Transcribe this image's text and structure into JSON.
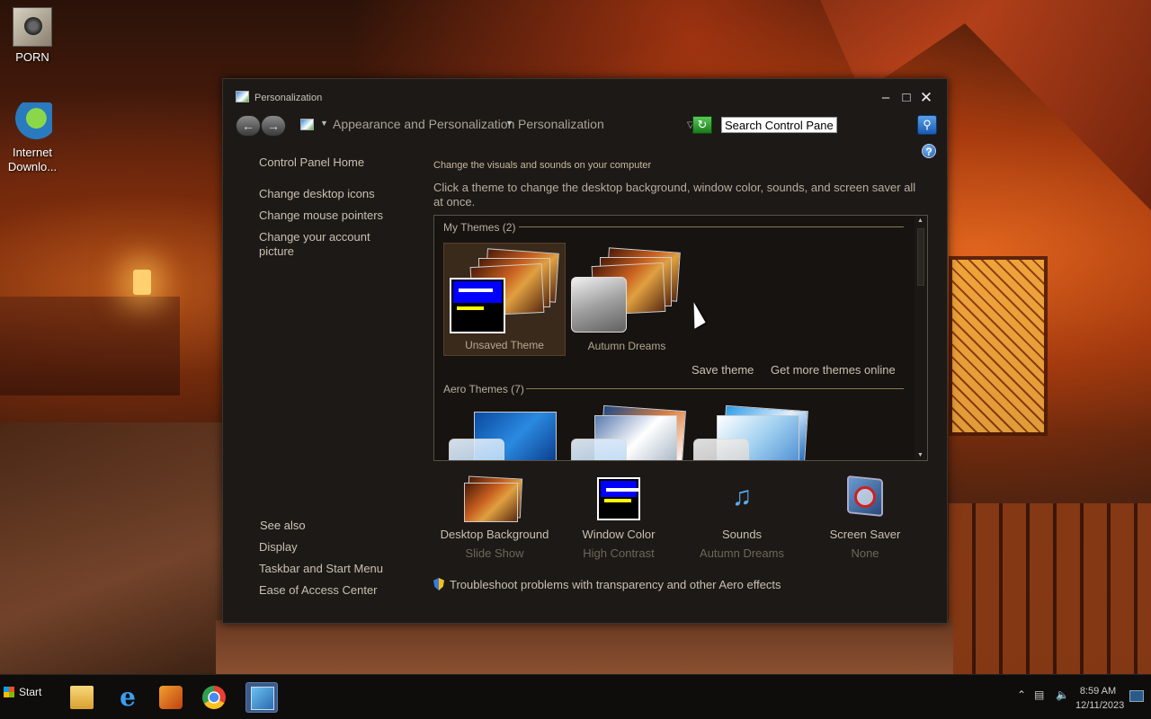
{
  "desktop": {
    "icons": [
      {
        "label": "PORN"
      },
      {
        "label": "Internet Downlo..."
      }
    ]
  },
  "window": {
    "title": "Personalization",
    "breadcrumb": [
      "Appearance and Personalization",
      "Personalization"
    ],
    "search_placeholder": "Search Control Panel"
  },
  "left_pane": {
    "home": "Control Panel Home",
    "links": [
      "Change desktop icons",
      "Change mouse pointers",
      "Change your account picture"
    ],
    "see_also_title": "See also",
    "see_also": [
      "Display",
      "Taskbar and Start Menu",
      "Ease of Access Center"
    ]
  },
  "main": {
    "heading": "Change the visuals and sounds on your computer",
    "description": "Click a theme to change the desktop background, window color, sounds, and screen saver all at once.",
    "my_themes_label": "My Themes (2)",
    "my_themes": [
      {
        "name": "Unsaved Theme",
        "selected": true
      },
      {
        "name": "Autumn Dreams",
        "selected": false
      }
    ],
    "save_theme": "Save theme",
    "get_more": "Get more themes online",
    "aero_themes_label": "Aero Themes (7)"
  },
  "bottom": [
    {
      "title": "Desktop Background",
      "value": "Slide Show",
      "icon": "desktop-background-icon"
    },
    {
      "title": "Window Color",
      "value": "High Contrast",
      "icon": "window-color-icon"
    },
    {
      "title": "Sounds",
      "value": "Autumn Dreams",
      "icon": "sounds-icon"
    },
    {
      "title": "Screen Saver",
      "value": "None",
      "icon": "screen-saver-icon"
    }
  ],
  "troubleshoot": "Troubleshoot problems with transparency and other Aero effects",
  "taskbar": {
    "start": "Start",
    "apps": [
      "file-explorer-icon",
      "internet-explorer-icon",
      "media-player-icon",
      "chrome-icon",
      "control-panel-icon"
    ],
    "time": "8:59 AM",
    "date": "12/11/2023"
  },
  "colors": {
    "window_bg": "#1c1916",
    "link": "#c9c0b0",
    "accent_line": "#8a7a55"
  }
}
